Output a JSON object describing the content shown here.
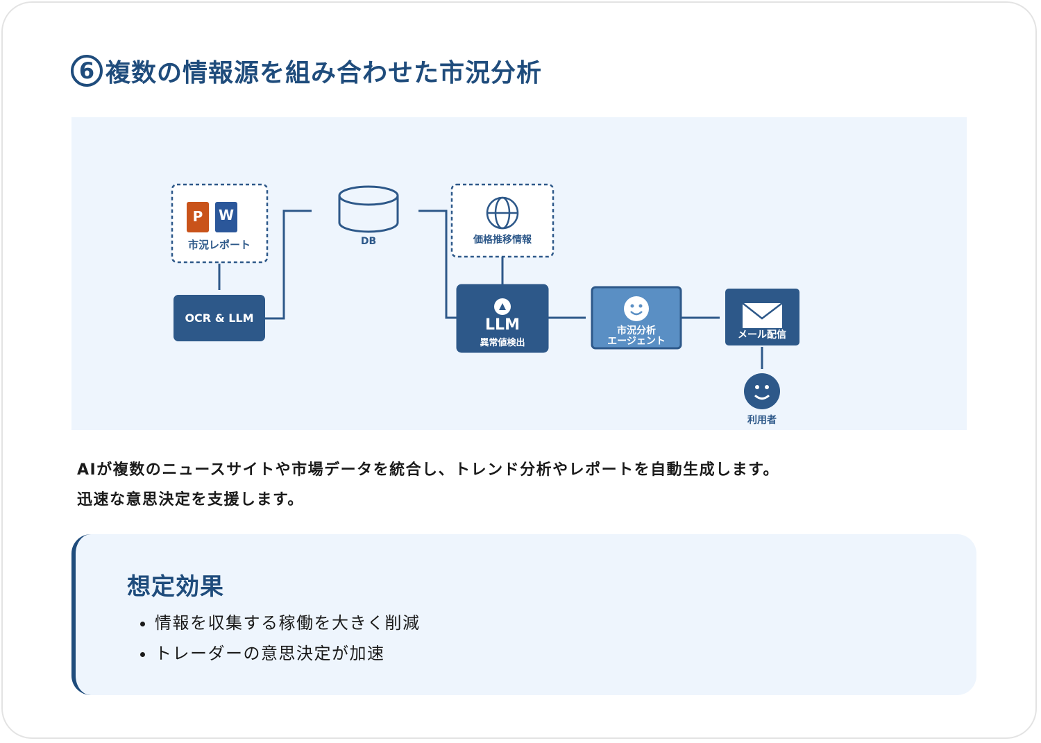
{
  "title": {
    "number": "6",
    "text": "複数の情報源を組み合わせた市況分析"
  },
  "diagram": {
    "report_label": "市況レポート",
    "p_icon_letter": "P",
    "w_icon_letter": "W",
    "ocr_label": "OCR & LLM",
    "db_label": "DB",
    "price_label": "価格推移情報",
    "llm_title": "LLM",
    "llm_sub": "異常値検出",
    "agent_line1": "市況分析",
    "agent_line2": "エージェント",
    "mail_label": "メール配信",
    "user_label": "利用者",
    "colors": {
      "navy": "#2d5889",
      "agent_blue": "#5a8fc4",
      "word_blue": "#2b579a",
      "ppt_orange": "#c9531a",
      "bg": "#eef5fd"
    }
  },
  "description": {
    "line1": "AIが複数のニュースサイトや市場データを統合し、トレンド分析やレポートを自動生成します。",
    "line2": "迅速な意思決定を支援します。"
  },
  "effects": {
    "title": "想定効果",
    "items": [
      "情報を収集する稼働を大きく削減",
      "トレーダーの意思決定が加速"
    ]
  }
}
